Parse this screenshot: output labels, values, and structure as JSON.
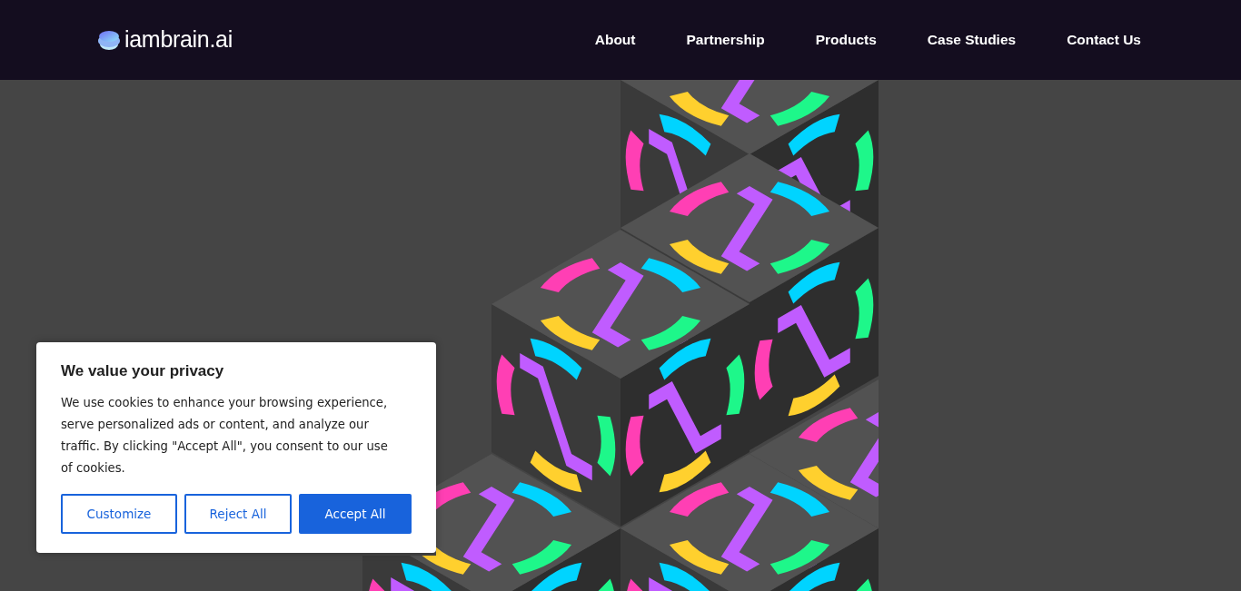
{
  "brand": {
    "name": "iambrain.ai"
  },
  "nav": [
    {
      "label": "About"
    },
    {
      "label": "Partnership"
    },
    {
      "label": "Products"
    },
    {
      "label": "Case Studies"
    },
    {
      "label": "Contact Us"
    }
  ],
  "cookie_banner": {
    "title": "We value your privacy",
    "text": "We use cookies to enhance your browsing experience, serve personalized ads or content, and analyze our traffic. By clicking \"Accept All\", you consent to our use of cookies.",
    "buttons": [
      {
        "label": "Customize",
        "kind": "outline"
      },
      {
        "label": "Reject All",
        "kind": "outline"
      },
      {
        "label": "Accept All",
        "kind": "primary"
      }
    ]
  }
}
